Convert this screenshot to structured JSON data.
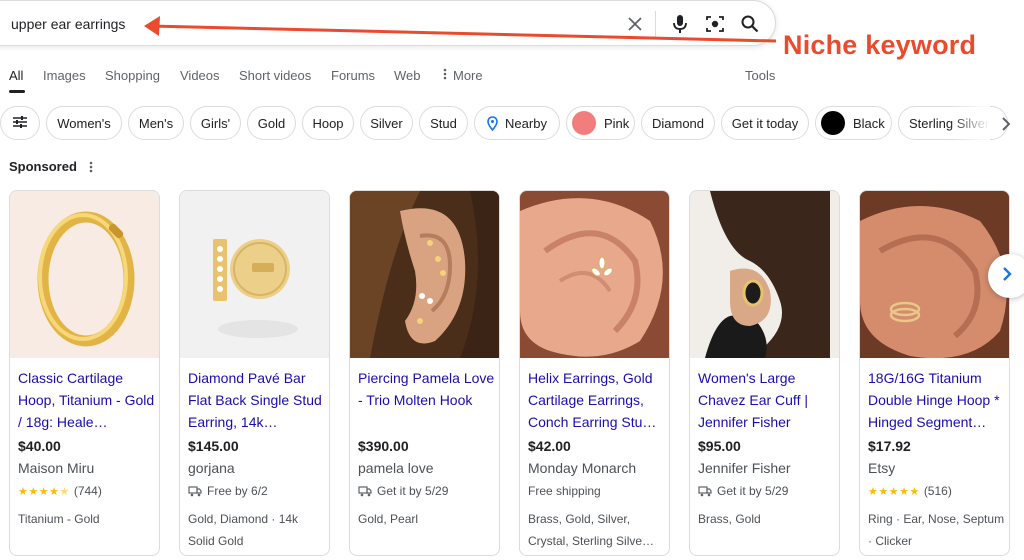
{
  "search": {
    "query": "upper ear earrings"
  },
  "annotation": {
    "text": "Niche keyword",
    "color": "#ea4b2c"
  },
  "tabs": [
    {
      "label": "All",
      "active": true
    },
    {
      "label": "Images"
    },
    {
      "label": "Shopping"
    },
    {
      "label": "Videos"
    },
    {
      "label": "Short videos"
    },
    {
      "label": "Forums"
    },
    {
      "label": "Web"
    },
    {
      "label": "More"
    }
  ],
  "tools_label": "Tools",
  "chips": [
    {
      "label": "Women's"
    },
    {
      "label": "Men's"
    },
    {
      "label": "Girls'"
    },
    {
      "label": "Gold"
    },
    {
      "label": "Hoop"
    },
    {
      "label": "Silver"
    },
    {
      "label": "Stud"
    },
    {
      "label": "Nearby",
      "icon": "location-pin-icon"
    },
    {
      "label": "Pink",
      "swatch": "#f27d7d"
    },
    {
      "label": "Diamond"
    },
    {
      "label": "Get it today"
    },
    {
      "label": "Black",
      "swatch": "#000000"
    },
    {
      "label": "Sterling Silver"
    }
  ],
  "sponsored_label": "Sponsored",
  "colors": {
    "link": "#1a0dab",
    "star": "#fbbc04",
    "text": "#202124",
    "muted": "#4d5156"
  },
  "products": [
    {
      "title": "Classic Cartilage Hoop, Titanium - Gold / 18g: Heale…",
      "price": "$40.00",
      "seller": "Maison Miru",
      "rating": 4.5,
      "reviews": "(744)",
      "tags": "Titanium - Gold"
    },
    {
      "title": "Diamond Pavé Bar Flat Back Single Stud Earring, 14k…",
      "price": "$145.00",
      "seller": "gorjana",
      "delivery": "Free by 6/2",
      "tags": "Gold, Diamond · 14k Solid Gold"
    },
    {
      "title": "Piercing Pamela Love - Trio Molten Hook",
      "price": "$390.00",
      "seller": "pamela love",
      "delivery": "Get it by 5/29",
      "tags": "Gold, Pearl"
    },
    {
      "title": "Helix Earrings, Gold Cartilage Earrings, Conch Earring Stu…",
      "price": "$42.00",
      "seller": "Monday Monarch",
      "shipping": "Free shipping",
      "tags": "Brass, Gold, Silver, Crystal, Sterling Silve…"
    },
    {
      "title": "Women's Large Chavez Ear Cuff | Jennifer Fisher",
      "price": "$95.00",
      "seller": "Jennifer Fisher",
      "delivery": "Get it by 5/29",
      "tags": "Brass, Gold"
    },
    {
      "title": "18G/16G Titanium Double Hinge Hoop * Hinged Segment…",
      "price": "$17.92",
      "seller": "Etsy",
      "rating": 5,
      "reviews": "(516)",
      "tags": "Ring · Ear, Nose, Septum · Clicker"
    }
  ]
}
